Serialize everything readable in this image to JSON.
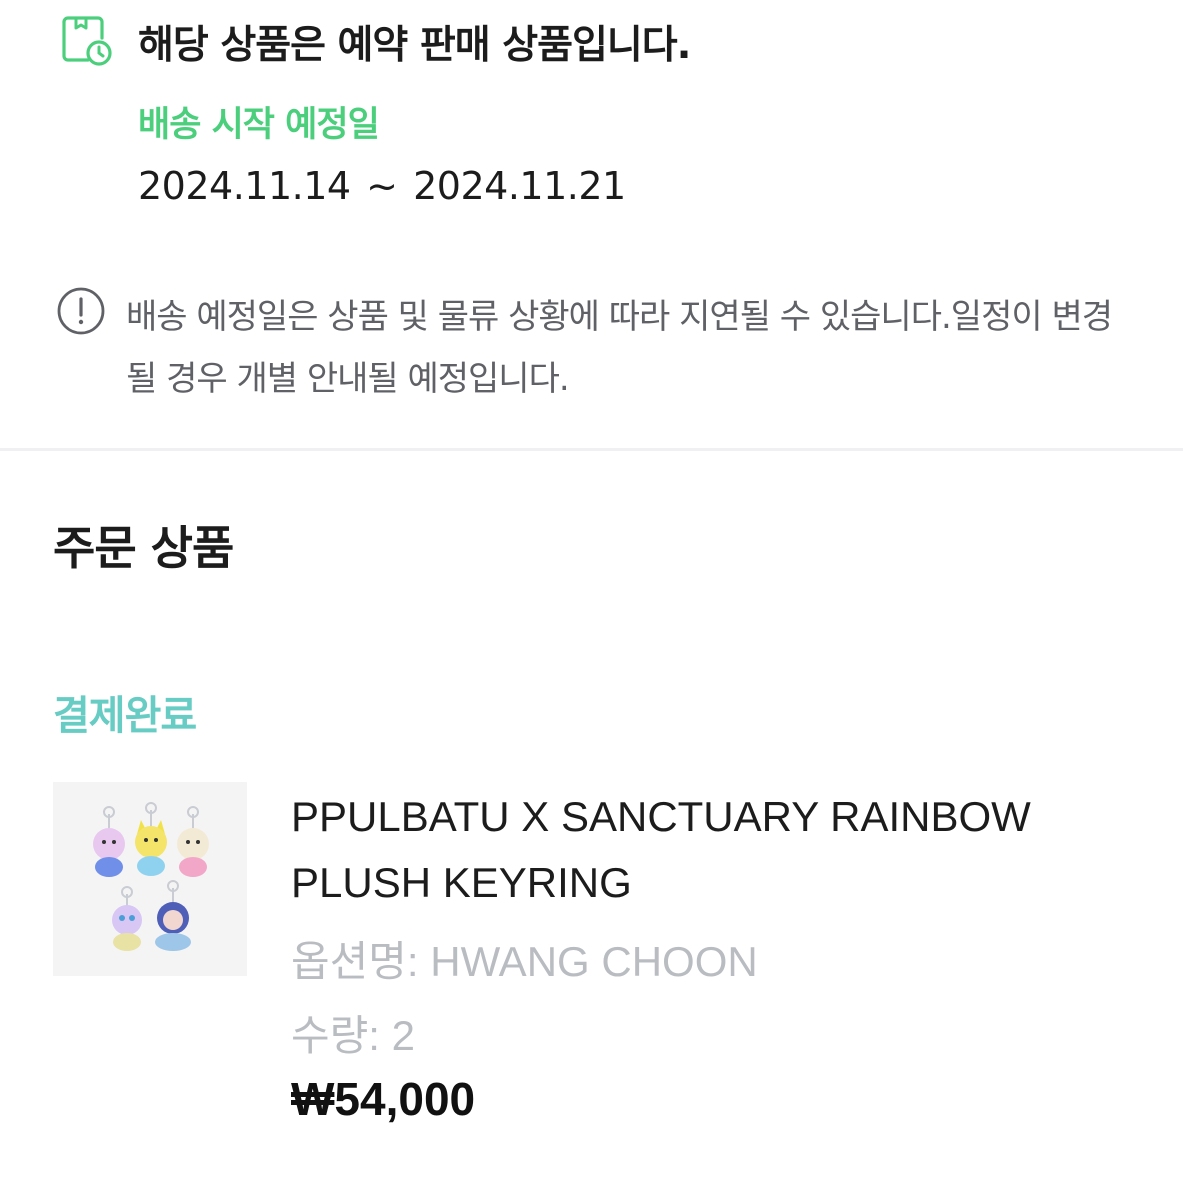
{
  "preorder": {
    "title": "해당 상품은 예약 판매 상품입니다.",
    "ship_label": "배송 시작 예정일",
    "ship_start": "2024.11.14",
    "ship_separator": "~",
    "ship_end": "2024.11.21",
    "notice": "배송 예정일은 상품 및 물류 상황에 따라 지연될 수 있습니다.일정이 변경될 경우 개별 안내될 예정입니다.",
    "icons": {
      "title": "calendar-clock-icon",
      "notice": "info-icon"
    },
    "colors": {
      "ship_label": "#4ccf7c",
      "notice_text": "#5f6166"
    }
  },
  "order": {
    "section_title": "주문 상품",
    "status": "결제완료",
    "status_color": "#67ccc4",
    "item": {
      "name": "PPULBATU X SANCTUARY RAINBOW PLUSH KEYRING",
      "option_label": "옵션명:",
      "option_value": "HWANG CHOON",
      "qty_label": "수량:",
      "qty_value": "2",
      "price": "₩54,000"
    }
  }
}
